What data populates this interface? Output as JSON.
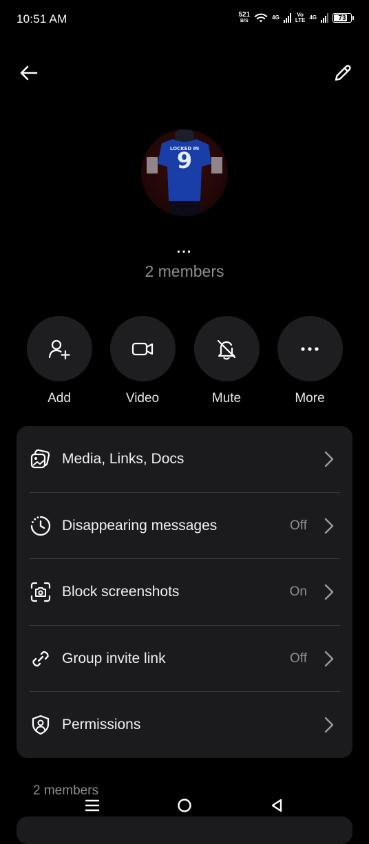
{
  "status_bar": {
    "time": "10:51 AM",
    "net_speed_value": "521",
    "net_speed_unit": "B/S",
    "network_1": "4G",
    "volte_top": "Vo",
    "volte_bottom": "LTE",
    "network_2": "4G",
    "battery": "73",
    "icons": [
      "wifi-icon",
      "signal-icon",
      "battery-icon"
    ]
  },
  "header": {
    "back_icon": "arrow-left-icon",
    "edit_icon": "pencil-icon"
  },
  "profile": {
    "avatar_text": "LOCKED IN",
    "avatar_number": "9",
    "name": "...",
    "members": "2 members"
  },
  "actions": [
    {
      "label": "Add",
      "icon": "add-user-icon"
    },
    {
      "label": "Video",
      "icon": "video-camera-icon"
    },
    {
      "label": "Mute",
      "icon": "bell-off-icon"
    },
    {
      "label": "More",
      "icon": "more-horizontal-icon"
    }
  ],
  "settings": [
    {
      "title": "Media, Links, Docs",
      "value": "",
      "icon": "media-icon"
    },
    {
      "title": "Disappearing messages",
      "value": "Off",
      "icon": "timer-icon"
    },
    {
      "title": "Block screenshots",
      "value": "On",
      "icon": "screenshot-camera-icon"
    },
    {
      "title": "Group invite link",
      "value": "Off",
      "icon": "link-icon"
    },
    {
      "title": "Permissions",
      "value": "",
      "icon": "shield-user-icon"
    }
  ],
  "members_section": {
    "header": "2 members"
  },
  "colors": {
    "background": "#000000",
    "card": "#1b1b1e",
    "button": "#1e1e21",
    "secondary_text": "#8e8e93"
  }
}
